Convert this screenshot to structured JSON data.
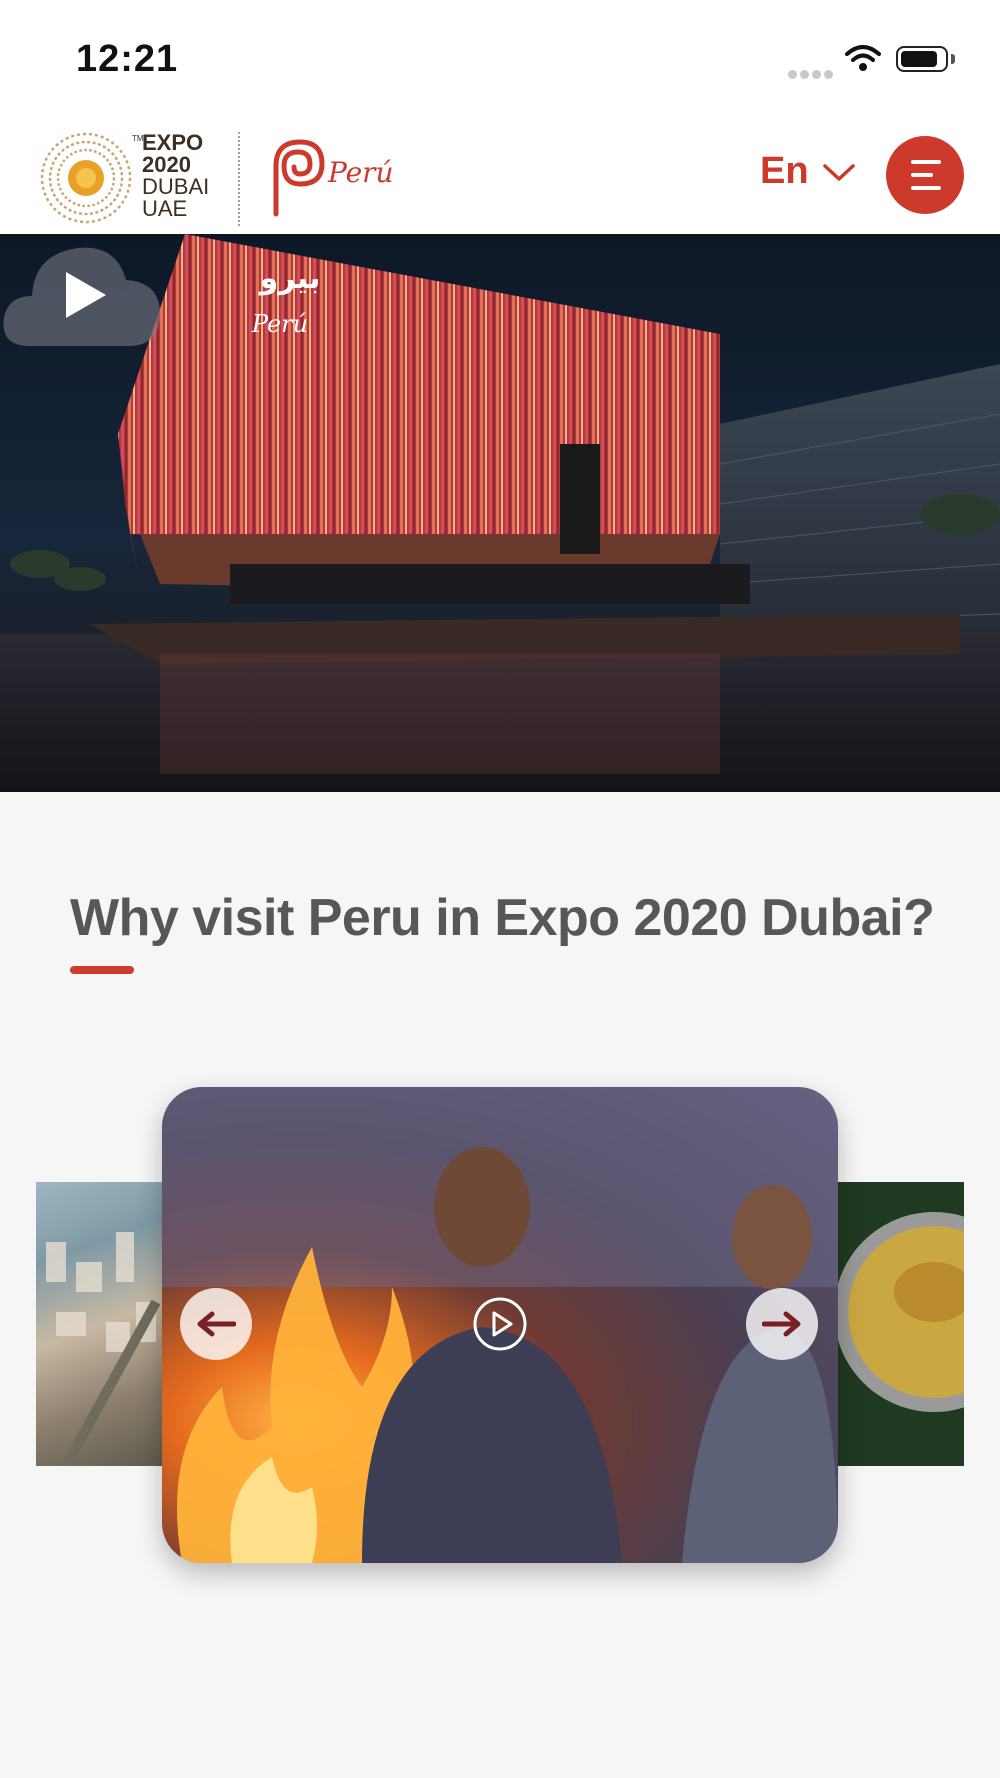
{
  "status_bar": {
    "time": "12:21",
    "icons": [
      "cellular-signal-icon",
      "wifi-icon",
      "battery-icon"
    ]
  },
  "header": {
    "expo_logo": {
      "lines": [
        "EXPO",
        "2020",
        "DUBAI",
        "UAE"
      ],
      "tm": "TM"
    },
    "peru_logo_text": "Perú",
    "language": "En",
    "menu_icon": "hamburger-menu-icon"
  },
  "hero": {
    "sign_arabic": "بيرو",
    "sign_latin": "Perú",
    "play_icon": "play-icon"
  },
  "section": {
    "title": "Why visit Peru in Expo 2020 Dubai?"
  },
  "carousel": {
    "prev_icon": "arrow-left-icon",
    "next_icon": "arrow-right-icon",
    "play_icon": "play-circle-icon"
  },
  "colors": {
    "accent": "#cd3a2c",
    "title_text": "#575757",
    "background": "#f6f6f6"
  }
}
